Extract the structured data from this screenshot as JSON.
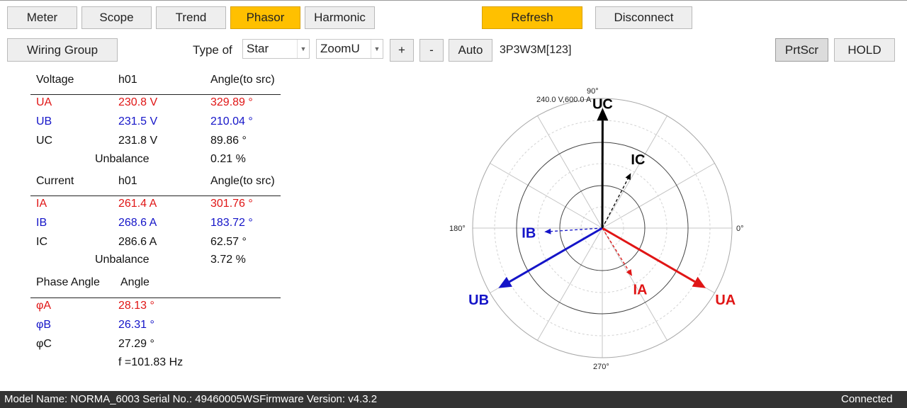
{
  "tabs": [
    "Meter",
    "Scope",
    "Trend",
    "Phasor",
    "Harmonic"
  ],
  "active_tab": "Phasor",
  "toolbar": {
    "refresh": "Refresh",
    "disconnect": "Disconnect",
    "wiring_group": "Wiring Group",
    "type_of_label": "Type of",
    "type_value": "Star",
    "zoom_value": "ZoomU",
    "plus": "+",
    "minus": "-",
    "auto": "Auto",
    "wiring_mode": "3P3W3M[123]",
    "prtscr": "PrtScr",
    "hold": "HOLD"
  },
  "voltage": {
    "header": [
      "Voltage",
      "h01",
      "Angle(to src)"
    ],
    "rows": [
      {
        "name": "UA",
        "value": "230.8 V",
        "angle": "329.89 °"
      },
      {
        "name": "UB",
        "value": "231.5 V",
        "angle": "210.04 °"
      },
      {
        "name": "UC",
        "value": "231.8 V",
        "angle": "89.86 °"
      }
    ],
    "unbalance_label": "Unbalance",
    "unbalance_value": "0.21 %"
  },
  "current": {
    "header": [
      "Current",
      "h01",
      "Angle(to src)"
    ],
    "rows": [
      {
        "name": "IA",
        "value": "261.4 A",
        "angle": "301.76 °"
      },
      {
        "name": "IB",
        "value": "268.6 A",
        "angle": "183.72 °"
      },
      {
        "name": "IC",
        "value": "286.6 A",
        "angle": "62.57 °"
      }
    ],
    "unbalance_label": "Unbalance",
    "unbalance_value": "3.72 %"
  },
  "phase_angle": {
    "header": [
      "Phase Angle",
      "Angle"
    ],
    "rows": [
      {
        "name": "φA",
        "value": "28.13 °"
      },
      {
        "name": "φB",
        "value": "26.31 °"
      },
      {
        "name": "φC",
        "value": "27.29 °"
      }
    ],
    "frequency": "f =101.83 Hz"
  },
  "phasor": {
    "scale_label": "240.0 V,600.0 A",
    "angle_labels": {
      "top": "90°",
      "left": "180°",
      "right": "0°",
      "bottom": "270°"
    },
    "colors": {
      "A": "#e01515",
      "B": "#1414c8",
      "C": "#000000"
    },
    "voltage_vectors": [
      {
        "label": "UA",
        "angle_deg": 329.89,
        "value": 230.8
      },
      {
        "label": "UB",
        "angle_deg": 210.04,
        "value": 231.5
      },
      {
        "label": "UC",
        "angle_deg": 89.86,
        "value": 231.8
      }
    ],
    "current_vectors": [
      {
        "label": "IA",
        "angle_deg": 301.76,
        "value": 261.4
      },
      {
        "label": "IB",
        "angle_deg": 183.72,
        "value": 268.6
      },
      {
        "label": "IC",
        "angle_deg": 62.57,
        "value": 286.6
      }
    ]
  },
  "status": {
    "model": "Model Name:  NORMA_6003 Serial No.:  49460005WSFirmware Version:  v4.3.2",
    "connection": "Connected"
  }
}
